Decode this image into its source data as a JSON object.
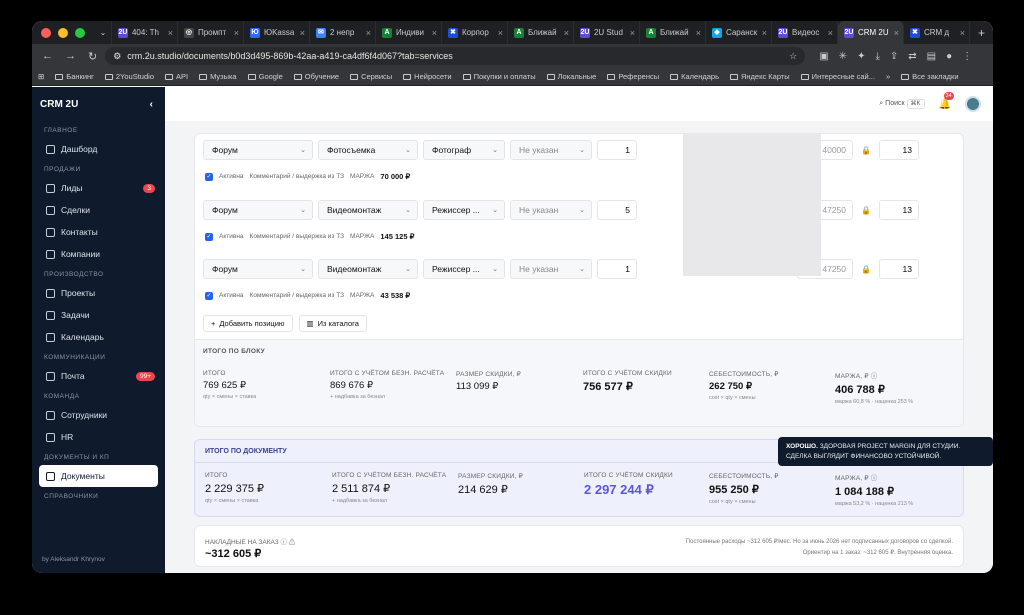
{
  "browser": {
    "tabs": [
      {
        "label": "404: Th",
        "fav": "2U",
        "color": "#5b4bd6"
      },
      {
        "label": "Промпт",
        "fav": "◎",
        "color": "#444"
      },
      {
        "label": "ЮKassa",
        "fav": "Ю",
        "color": "#2b6cff"
      },
      {
        "label": "2 непр",
        "fav": "✉",
        "color": "#3b82f6"
      },
      {
        "label": "Индиви",
        "fav": "A",
        "color": "#1a7f37"
      },
      {
        "label": "Корпор",
        "fav": "✖",
        "color": "#1d4ed8"
      },
      {
        "label": "Ближай",
        "fav": "A",
        "color": "#1a7f37"
      },
      {
        "label": "2U Stud",
        "fav": "2U",
        "color": "#5b4bd6"
      },
      {
        "label": "Ближай",
        "fav": "A",
        "color": "#1a7f37"
      },
      {
        "label": "Саранск",
        "fav": "◆",
        "color": "#0ea5e9"
      },
      {
        "label": "Видеос",
        "fav": "2U",
        "color": "#5b4bd6"
      },
      {
        "label": "CRM 2U",
        "fav": "2U",
        "color": "#5b4bd6",
        "active": true
      },
      {
        "label": "CRM д",
        "fav": "✖",
        "color": "#1d4ed8"
      }
    ],
    "url": "crm.2u.studio/documents/b0d3d495-869b-42aa-a419-ca4df6f4d067?tab=services",
    "bookmarks": [
      "Банкинг",
      "2YouStudio",
      "API",
      "Музыка",
      "Google",
      "Обучение",
      "Сервисы",
      "Нейросети",
      "Покупки и оплаты",
      "Локальные",
      "Референсы",
      "Календарь",
      "Яндекс Карты",
      "Интересные сай...",
      "»",
      "Все закладки"
    ]
  },
  "sidebar": {
    "brand": "CRM 2U",
    "collapse": "‹",
    "sections": [
      {
        "title": "ГЛАВНОЕ",
        "items": [
          {
            "label": "Дашборд"
          }
        ]
      },
      {
        "title": "ПРОДАЖИ",
        "items": [
          {
            "label": "Лиды",
            "badge": "3"
          },
          {
            "label": "Сделки"
          },
          {
            "label": "Контакты"
          },
          {
            "label": "Компании"
          }
        ]
      },
      {
        "title": "ПРОИЗВОДСТВО",
        "items": [
          {
            "label": "Проекты"
          },
          {
            "label": "Задачи"
          },
          {
            "label": "Календарь"
          }
        ]
      },
      {
        "title": "КОММУНИКАЦИИ",
        "items": [
          {
            "label": "Почта",
            "badge": "99+"
          }
        ]
      },
      {
        "title": "КОМАНДА",
        "items": [
          {
            "label": "Сотрудники"
          },
          {
            "label": "HR"
          }
        ]
      },
      {
        "title": "ДОКУМЕНТЫ И КП",
        "items": [
          {
            "label": "Документы",
            "active": true
          }
        ]
      },
      {
        "title": "СПРАВОЧНИКИ",
        "items": []
      }
    ],
    "footer": "by Aleksandr Khrynov"
  },
  "topbar": {
    "search": "Поиск",
    "kbd": "⌘K",
    "notif_count": "34"
  },
  "positions": [
    {
      "platform": "Форум",
      "service": "Фотосъемка",
      "role": "Фотограф",
      "extra": "Не указан",
      "qty": "1",
      "price": "40000",
      "units": "13",
      "active": "Активна",
      "comment": "Комментарий / выдержка из ТЗ",
      "margin_label": "МАРЖА",
      "margin": "70 000 ₽"
    },
    {
      "platform": "Форум",
      "service": "Видеомонтаж",
      "role": "Режиссер ...",
      "extra": "Не указан",
      "qty": "5",
      "price": "47250",
      "units": "13",
      "active": "Активна",
      "comment": "Комментарий / выдержка из ТЗ",
      "margin_label": "МАРЖА",
      "margin": "145 125 ₽"
    },
    {
      "platform": "Форум",
      "service": "Видеомонтаж",
      "role": "Режиссер ...",
      "extra": "Не указан",
      "qty": "1",
      "price": "47250",
      "units": "13",
      "active": "Активна",
      "comment": "Комментарий / выдержка из ТЗ",
      "margin_label": "МАРЖА",
      "margin": "43 538 ₽"
    }
  ],
  "actions": {
    "add": "Добавить позицию",
    "catalog": "Из каталога"
  },
  "block_totals": {
    "title": "ИТОГО ПО БЛОКУ",
    "cols": [
      {
        "label": "ИТОГО",
        "value": "769 625 ₽",
        "note": "qty × смены × ставка"
      },
      {
        "label": "ИТОГО С УЧЁТОМ БЕЗН. РАСЧЁТА",
        "value": "869 676 ₽",
        "note": "+ надбавка за безнал"
      },
      {
        "label": "РАЗМЕР СКИДКИ, ₽",
        "value": "113 099 ₽",
        "note": ""
      },
      {
        "label": "ИТОГО С УЧЁТОМ СКИДКИ",
        "value": "756 577 ₽",
        "note": ""
      },
      {
        "label": "СЕБЕСТОИМОСТЬ, ₽",
        "value": "262 750 ₽",
        "note": "cost × qty × смены"
      },
      {
        "label": "МАРЖА, ₽ ⓘ",
        "value": "406 788 ₽",
        "note": "маржа 60,8 % · наценка 253 %"
      }
    ]
  },
  "doc_totals": {
    "title": "ИТОГО ПО ДОКУМЕНТУ",
    "cols": [
      {
        "label": "ИТОГО",
        "value": "2 229 375 ₽",
        "note": "qty × смены × ставка"
      },
      {
        "label": "ИТОГО С УЧЁТОМ БЕЗН. РАСЧЁТА",
        "value": "2 511 874 ₽",
        "note": "+ надбавка за безнал"
      },
      {
        "label": "РАЗМЕР СКИДКИ, ₽",
        "value": "214 629 ₽",
        "note": ""
      },
      {
        "label": "ИТОГО С УЧЁТОМ СКИДКИ",
        "value": "2 297 244 ₽",
        "note": ""
      },
      {
        "label": "СЕБЕСТОИМОСТЬ, ₽",
        "value": "955 250 ₽",
        "note": "cost × qty × смены"
      },
      {
        "label": "МАРЖА, ₽ ⓘ",
        "value": "1 084 188 ₽",
        "note": "маржа 53,2 % · наценка 213 %"
      }
    ]
  },
  "tooltip": {
    "strong": "ХОРОШО.",
    "text": "ЗДОРОВАЯ PROJECT MARGIN ДЛЯ СТУДИИ. СДЕЛКА ВЫГЛЯДИТ ФИНАНСОВО УСТОЙЧИВОЙ."
  },
  "overhead": {
    "label": "НАКЛАДНЫЕ НА ЗАКАЗ ⓘ ⚠",
    "value": "~312 605 ₽",
    "line1": "Постоянные расходы ~312 605 ₽/мес. Но за июнь 2026 нет подписанных договоров со сделкой.",
    "line2": "Ориентир на 1 заказ: ~312 605 ₽. Внутренняя оценка."
  }
}
